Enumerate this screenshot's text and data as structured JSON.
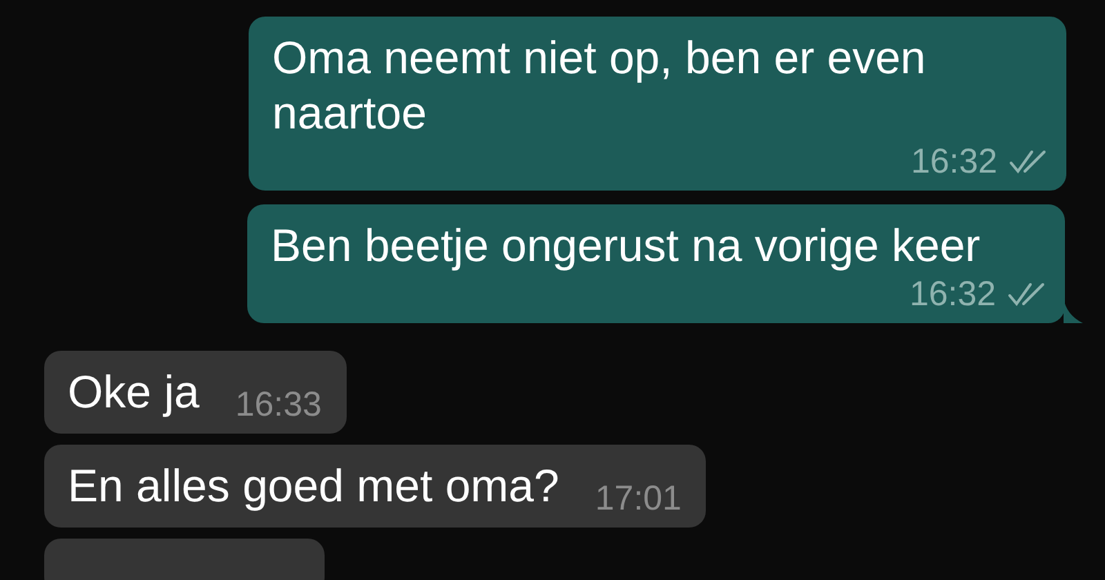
{
  "messages": [
    {
      "kind": "outgoing",
      "text": "Oma neemt niet op, ben er even naartoe",
      "time": "16:32",
      "delivered": true,
      "tail": false
    },
    {
      "kind": "outgoing",
      "text": "Ben beetje ongerust na vorige keer",
      "time": "16:32",
      "delivered": true,
      "tail": true
    },
    {
      "kind": "incoming",
      "text": "Oke ja",
      "time": "16:33",
      "tail": false
    },
    {
      "kind": "incoming",
      "text": "En alles goed met oma?",
      "time": "17:01",
      "tail": false
    },
    {
      "kind": "incoming",
      "tail": false
    }
  ]
}
